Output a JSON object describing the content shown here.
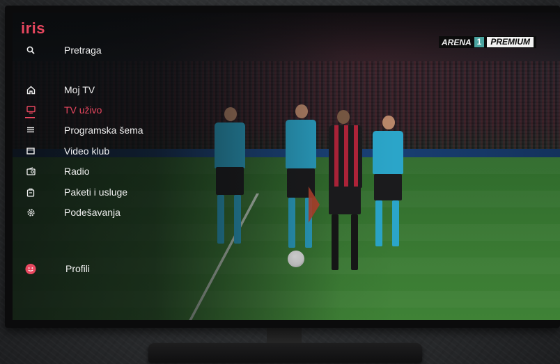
{
  "app": {
    "logo": "iris"
  },
  "channel": {
    "name": "ARENA",
    "number": "1",
    "tier": "PREMIUM"
  },
  "menu": {
    "search": {
      "label": "Pretraga",
      "icon": "search-icon"
    },
    "items": [
      {
        "label": "Moj TV",
        "icon": "home-icon",
        "active": false
      },
      {
        "label": "TV uživo",
        "icon": "tv-icon",
        "active": true
      },
      {
        "label": "Programska šema",
        "icon": "list-icon",
        "active": false
      },
      {
        "label": "Video klub",
        "icon": "film-icon",
        "active": false
      },
      {
        "label": "Radio",
        "icon": "radio-icon",
        "active": false
      },
      {
        "label": "Paketi i usluge",
        "icon": "package-icon",
        "active": false
      },
      {
        "label": "Podešavanja",
        "icon": "gear-icon",
        "active": false
      }
    ],
    "profile": {
      "label": "Profili",
      "icon": "profile-smiley-icon"
    }
  },
  "colors": {
    "accent": "#e8475f",
    "menu_text": "#f0f0f0",
    "badge_number_bg": "#4aa4a0"
  }
}
